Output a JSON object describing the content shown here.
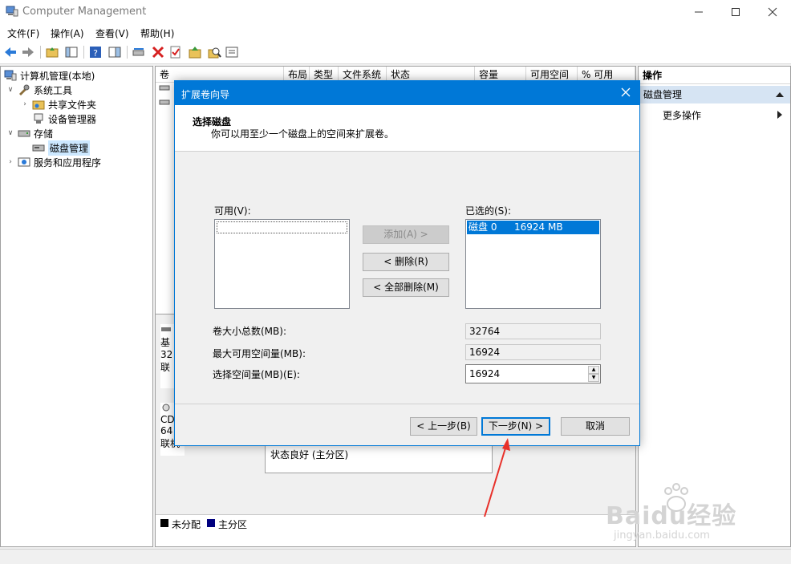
{
  "window": {
    "title": "Computer Management"
  },
  "menu": [
    "文件(F)",
    "操作(A)",
    "查看(V)",
    "帮助(H)"
  ],
  "tree": {
    "root": "计算机管理(本地)",
    "system_tools": "系统工具",
    "shared_folders": "共享文件夹",
    "device_manager": "设备管理器",
    "storage": "存储",
    "disk_management": "磁盘管理",
    "services": "服务和应用程序"
  },
  "columns": [
    "卷",
    "布局",
    "类型",
    "文件系统",
    "状态",
    "容量",
    "可用空间",
    "% 可用"
  ],
  "disks": {
    "disk0_lines": [
      "基",
      "32",
      "联"
    ],
    "cd_lines": [
      "CD",
      "64",
      "联机"
    ],
    "partition_status": "状态良好 (主分区)"
  },
  "legend": {
    "unallocated": "未分配",
    "primary": "主分区",
    "unallocated_color": "#000000",
    "primary_color": "#00007f"
  },
  "actions": {
    "header": "操作",
    "section": "磁盘管理",
    "more": "更多操作"
  },
  "dialog": {
    "title": "扩展卷向导",
    "heading": "选择磁盘",
    "subheading": "你可以用至少一个磁盘上的空间来扩展卷。",
    "available_label": "可用(V):",
    "selected_label": "已选的(S):",
    "selected_items": [
      {
        "disk": "磁盘 0",
        "size": "16924 MB"
      }
    ],
    "add_button": "添加(A) >",
    "remove_button": "< 删除(R)",
    "remove_all_button": "< 全部删除(M)",
    "total_size_label": "卷大小总数(MB):",
    "total_size_value": "32764",
    "max_space_label": "最大可用空间量(MB):",
    "max_space_value": "16924",
    "select_space_label": "选择空间量(MB)(E):",
    "select_space_value": "16924",
    "back_button": "< 上一步(B)",
    "next_button": "下一步(N) >",
    "cancel_button": "取消"
  },
  "watermark": {
    "brand": "Baidu经验",
    "url": "jingyan.baidu.com"
  },
  "colors": {
    "accent": "#0078d7",
    "selection": "#0078d7",
    "annotation_arrow": "#e8302a"
  }
}
